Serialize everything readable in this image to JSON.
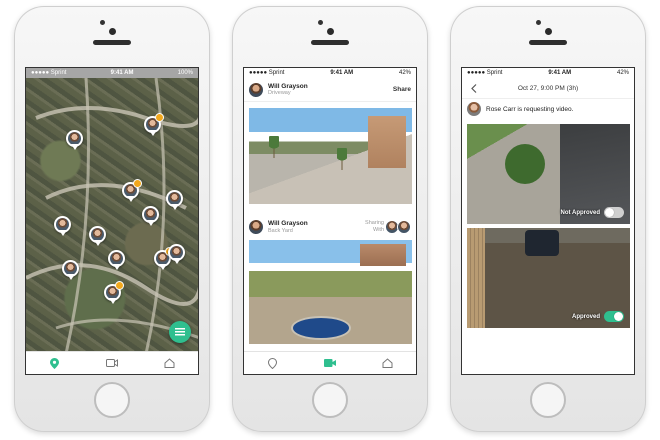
{
  "colors": {
    "accent": "#2fbf8f",
    "pin_badge": "#f2a81d",
    "toggle_off": "#cfcfcf"
  },
  "phone1": {
    "status": {
      "carrier": "●●●●● Sprint",
      "time": "9:41 AM",
      "battery": "100%"
    },
    "tabs": [
      {
        "icon": "map-pin-icon",
        "active": true
      },
      {
        "icon": "video-camera-icon",
        "active": false
      },
      {
        "icon": "home-icon",
        "active": false
      }
    ],
    "fab_icon": "list-icon",
    "pins": [
      {
        "badge": false
      },
      {
        "badge": true
      },
      {
        "badge": false
      },
      {
        "badge": true
      },
      {
        "badge": false
      },
      {
        "badge": false
      },
      {
        "badge": false
      },
      {
        "badge": false
      },
      {
        "badge": true
      },
      {
        "badge": false
      },
      {
        "badge": true
      },
      {
        "badge": false
      }
    ]
  },
  "phone2": {
    "status": {
      "carrier": "●●●●● Sprint",
      "time": "9:41 AM",
      "battery": "42%"
    },
    "post1": {
      "name": "Will Grayson",
      "location": "Driveway",
      "action": "Share"
    },
    "post2": {
      "name": "Will Grayson",
      "location": "Back Yard",
      "sharing_label": "Sharing",
      "sharing_with": "With"
    },
    "tabs": [
      {
        "icon": "map-pin-icon",
        "active": false
      },
      {
        "icon": "video-camera-icon",
        "active": true
      },
      {
        "icon": "home-icon",
        "active": false
      }
    ]
  },
  "phone3": {
    "status": {
      "carrier": "●●●●● Sprint",
      "time": "9:41 AM",
      "battery": "42%"
    },
    "title": "Oct 27, 9:00 PM (3h)",
    "request_text": "Rose Carr is requesting video.",
    "clips": [
      {
        "label": "Not Approved",
        "approved": false
      },
      {
        "label": "Approved",
        "approved": true
      }
    ]
  }
}
